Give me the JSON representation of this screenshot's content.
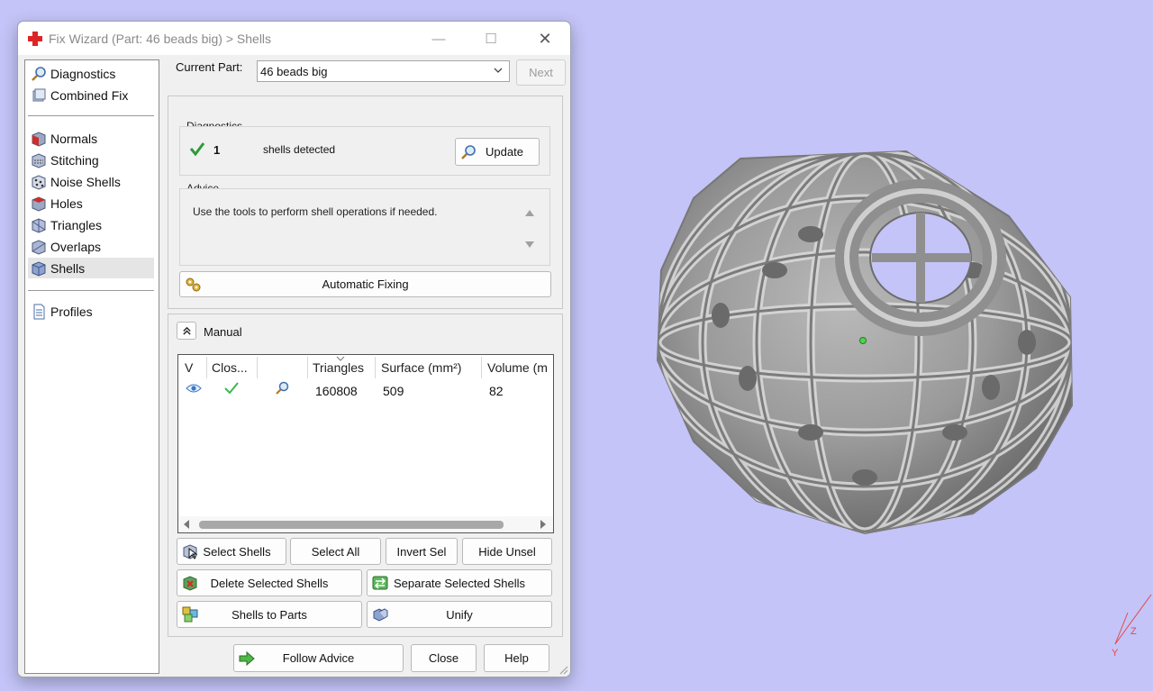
{
  "window": {
    "title": "Fix Wizard (Part: 46 beads big) > Shells"
  },
  "nav": {
    "items_top": [
      {
        "label": "Diagnostics",
        "icon": "magnifier-icon"
      },
      {
        "label": "Combined Fix",
        "icon": "combined-fix-icon"
      }
    ],
    "items_mid": [
      {
        "label": "Normals",
        "icon": "normals-icon"
      },
      {
        "label": "Stitching",
        "icon": "stitching-icon"
      },
      {
        "label": "Noise Shells",
        "icon": "noise-shells-icon"
      },
      {
        "label": "Holes",
        "icon": "holes-icon"
      },
      {
        "label": "Triangles",
        "icon": "triangles-icon"
      },
      {
        "label": "Overlaps",
        "icon": "overlaps-icon"
      },
      {
        "label": "Shells",
        "icon": "shells-icon",
        "selected": true
      }
    ],
    "items_bottom": [
      {
        "label": "Profiles",
        "icon": "document-icon"
      }
    ]
  },
  "current_part": {
    "label": "Current Part:",
    "value": "46 beads big",
    "next_label": "Next"
  },
  "diagnostics": {
    "title": "Diagnostics",
    "count": "1",
    "text": "shells detected",
    "update_label": "Update"
  },
  "advice": {
    "title": "Advice",
    "text": "Use the tools to perform shell operations if needed."
  },
  "automatic_fixing_label": "Automatic Fixing",
  "manual": {
    "title": "Manual",
    "columns": [
      "V",
      "Clos...",
      "",
      "Triangles",
      "Surface (mm²)",
      "Volume (m"
    ],
    "rows": [
      {
        "triangles": "160808",
        "surface": "509",
        "volume": "82"
      }
    ]
  },
  "buttons": {
    "select_shells": "Select Shells",
    "select_all": "Select All",
    "invert_sel": "Invert Sel",
    "hide_unsel": "Hide Unsel",
    "delete_selected": "Delete Selected Shells",
    "separate_selected": "Separate Selected Shells",
    "shells_to_parts": "Shells to Parts",
    "unify": "Unify",
    "follow_advice": "Follow Advice",
    "close": "Close",
    "help": "Help"
  },
  "viewport": {
    "axis_label": "Z",
    "axis_label2": "Y",
    "background": "#c4c4f8"
  }
}
